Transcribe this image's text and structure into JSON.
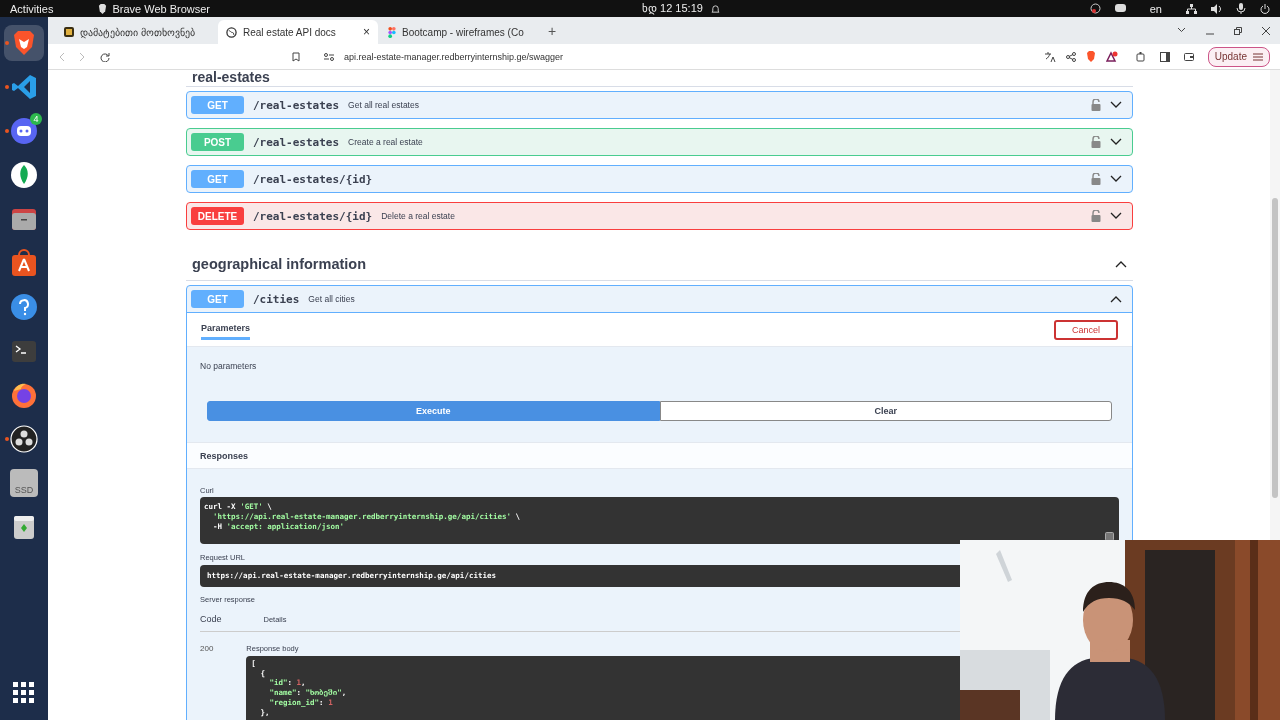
{
  "top_bar": {
    "activities": "Activities",
    "app_name": "Brave Web Browser",
    "clock": "ხდ 12 15:19",
    "keyboard_layout": "en"
  },
  "dock": {
    "items": [
      {
        "kind": "brave",
        "running": true,
        "selected": true
      },
      {
        "kind": "code",
        "running": true,
        "selected": false
      },
      {
        "kind": "chat",
        "running": true,
        "selected": false,
        "badge": "4"
      },
      {
        "kind": "leaf",
        "running": false,
        "selected": false
      },
      {
        "kind": "folder",
        "running": false,
        "selected": false
      },
      {
        "kind": "store",
        "running": false,
        "selected": false
      },
      {
        "kind": "help",
        "running": false,
        "selected": false
      },
      {
        "kind": "terminal",
        "running": false,
        "selected": false
      },
      {
        "kind": "fox",
        "running": false,
        "selected": false
      },
      {
        "kind": "obs",
        "running": true,
        "selected": false
      },
      {
        "kind": "drive",
        "running": false,
        "selected": false,
        "label": "SSD"
      },
      {
        "kind": "trash",
        "running": false,
        "selected": false
      }
    ]
  },
  "browser": {
    "tabs": [
      {
        "kind": "page",
        "title": "დამატებითი მოთხოვნებ",
        "selected": false
      },
      {
        "kind": "globe",
        "title": "Real estate API docs",
        "selected": true,
        "close": "×"
      },
      {
        "kind": "design",
        "title": "Bootcamp - wireframes (Co",
        "selected": false
      }
    ],
    "new_tab": "+",
    "address": "api.real-estate-manager.redberryinternship.ge/swagger",
    "update_button": "Update"
  },
  "swagger": {
    "section_partial": "real-estates",
    "operations": [
      {
        "kind": "get",
        "method": "GET",
        "path": "/real-estates",
        "summary": "Get all real estates"
      },
      {
        "kind": "post",
        "method": "POST",
        "path": "/real-estates",
        "summary": "Create a real estate"
      },
      {
        "kind": "get",
        "method": "GET",
        "path": "/real-estates/{id}"
      },
      {
        "kind": "delete",
        "method": "DELETE",
        "path": "/real-estates/{id}",
        "summary": "Delete a real estate"
      }
    ],
    "section": {
      "title": "geographical information",
      "expanded": true
    },
    "open_operation": {
      "kind": "get",
      "method": "GET",
      "path": "/cities",
      "summary": "Get all cities",
      "expanded": true,
      "tabs": [
        {
          "label": "Parameters",
          "selected": true
        }
      ],
      "cancel": "Cancel",
      "no_params": "No parameters",
      "execute": "Execute",
      "clear": "Clear",
      "responses_title": "Responses",
      "curl_label": "Curl",
      "curl_lines": [
        "curl -X 'GET' \\",
        "  'https://api.real-estate-manager.redberryinternship.ge/api/cities' \\",
        "  -H 'accept: application/json'"
      ],
      "request_url_label": "Request URL",
      "request_url": "https://api.real-estate-manager.redberryinternship.ge/api/cities",
      "server_response_label": "Server response",
      "columns": [
        "Code",
        "Details"
      ],
      "code": "200",
      "response_body_label": "Response body",
      "response_body_lines": [
        "[",
        "  {",
        "    \"id\": 1,",
        "    \"name\": \"ხობეში\",",
        "    \"region_id\": 1",
        "  },"
      ]
    }
  }
}
